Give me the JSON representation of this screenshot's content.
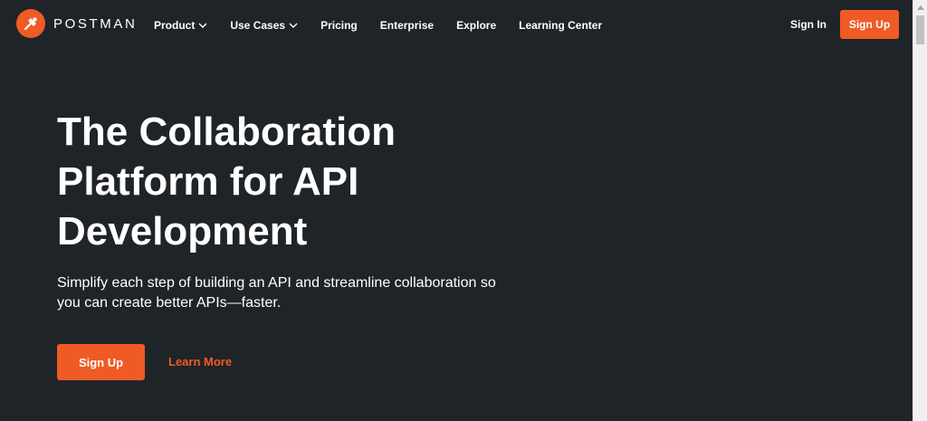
{
  "header": {
    "logo_text": "POSTMAN",
    "nav": [
      {
        "label": "Product",
        "dropdown": true
      },
      {
        "label": "Use Cases",
        "dropdown": true
      },
      {
        "label": "Pricing",
        "dropdown": false
      },
      {
        "label": "Enterprise",
        "dropdown": false
      },
      {
        "label": "Explore",
        "dropdown": false
      },
      {
        "label": "Learning Center",
        "dropdown": false
      }
    ],
    "signin_label": "Sign In",
    "signup_label": "Sign Up"
  },
  "hero": {
    "title_lines": [
      "The Collaboration",
      "Platform for API",
      "Development"
    ],
    "subtitle_lines": [
      "Simplify each step of building an API and streamline collaboration so",
      "you can create better APIs—faster."
    ],
    "primary_button": "Sign Up",
    "secondary_link": "Learn More"
  },
  "colors": {
    "background": "#1f2429",
    "accent": "#ef5b25",
    "text": "#ffffff"
  },
  "icons": {
    "logo": "postman-rocket-icon",
    "dropdown": "chevron-down-icon",
    "scroll_up": "scroll-up-arrow-icon"
  }
}
